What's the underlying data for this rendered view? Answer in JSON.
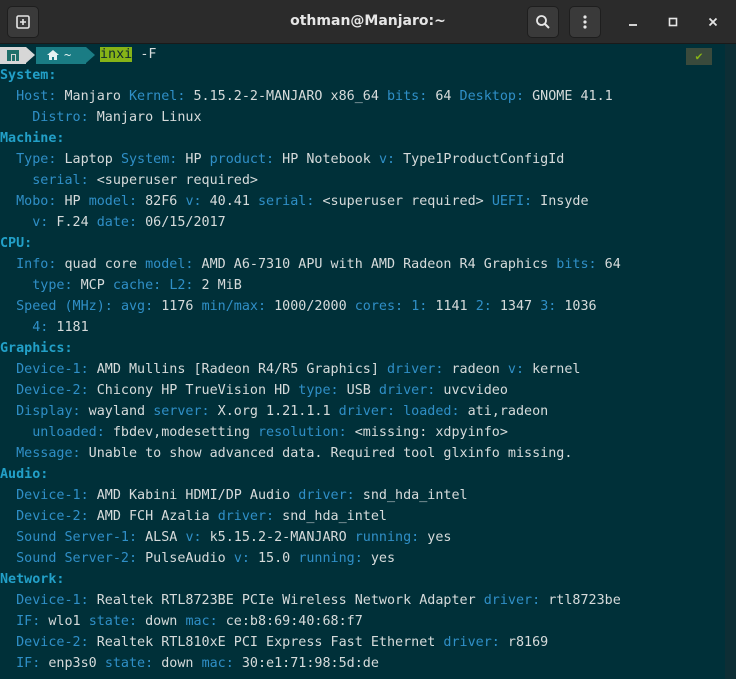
{
  "window": {
    "title": "othman@Manjaro:~"
  },
  "prompt": {
    "home_label": "~",
    "command": "inxi",
    "args": "-F",
    "status": "✔"
  },
  "colors": {
    "background": "#003039",
    "key": "#2f8fc7",
    "section": "#22a0c8",
    "value": "#d6dbdb",
    "command_highlight": "#86b317"
  },
  "output": [
    [
      {
        "t": "System:",
        "c": "s"
      }
    ],
    [
      {
        "t": "  Host:",
        "c": "k"
      },
      {
        "t": " Manjaro ",
        "c": "v"
      },
      {
        "t": "Kernel:",
        "c": "k"
      },
      {
        "t": " 5.15.2-2-MANJARO x86_64 ",
        "c": "v"
      },
      {
        "t": "bits:",
        "c": "k"
      },
      {
        "t": " 64 ",
        "c": "v"
      },
      {
        "t": "Desktop:",
        "c": "k"
      },
      {
        "t": " GNOME 41.1",
        "c": "v"
      }
    ],
    [
      {
        "t": "    Distro:",
        "c": "k"
      },
      {
        "t": " Manjaro Linux",
        "c": "v"
      }
    ],
    [
      {
        "t": "Machine:",
        "c": "s"
      }
    ],
    [
      {
        "t": "  Type:",
        "c": "k"
      },
      {
        "t": " Laptop ",
        "c": "v"
      },
      {
        "t": "System:",
        "c": "k"
      },
      {
        "t": " HP ",
        "c": "v"
      },
      {
        "t": "product:",
        "c": "k"
      },
      {
        "t": " HP Notebook ",
        "c": "v"
      },
      {
        "t": "v:",
        "c": "k"
      },
      {
        "t": " Type1ProductConfigId",
        "c": "v"
      }
    ],
    [
      {
        "t": "    serial:",
        "c": "k"
      },
      {
        "t": " <superuser required>",
        "c": "v"
      }
    ],
    [
      {
        "t": "  Mobo:",
        "c": "k"
      },
      {
        "t": " HP ",
        "c": "v"
      },
      {
        "t": "model:",
        "c": "k"
      },
      {
        "t": " 82F6 ",
        "c": "v"
      },
      {
        "t": "v:",
        "c": "k"
      },
      {
        "t": " 40.41 ",
        "c": "v"
      },
      {
        "t": "serial:",
        "c": "k"
      },
      {
        "t": " <superuser required> ",
        "c": "v"
      },
      {
        "t": "UEFI:",
        "c": "k"
      },
      {
        "t": " Insyde",
        "c": "v"
      }
    ],
    [
      {
        "t": "    v:",
        "c": "k"
      },
      {
        "t": " F.24 ",
        "c": "v"
      },
      {
        "t": "date:",
        "c": "k"
      },
      {
        "t": " 06/15/2017",
        "c": "v"
      }
    ],
    [
      {
        "t": "CPU:",
        "c": "s"
      }
    ],
    [
      {
        "t": "  Info:",
        "c": "k"
      },
      {
        "t": " quad core ",
        "c": "v"
      },
      {
        "t": "model:",
        "c": "k"
      },
      {
        "t": " AMD A6-7310 APU with AMD Radeon R4 Graphics ",
        "c": "v"
      },
      {
        "t": "bits:",
        "c": "k"
      },
      {
        "t": " 64",
        "c": "v"
      }
    ],
    [
      {
        "t": "    type:",
        "c": "k"
      },
      {
        "t": " MCP ",
        "c": "v"
      },
      {
        "t": "cache:",
        "c": "k"
      },
      {
        "t": " ",
        "c": "v"
      },
      {
        "t": "L2:",
        "c": "k"
      },
      {
        "t": " 2 MiB",
        "c": "v"
      }
    ],
    [
      {
        "t": "  Speed (MHz):",
        "c": "k"
      },
      {
        "t": " ",
        "c": "v"
      },
      {
        "t": "avg:",
        "c": "k"
      },
      {
        "t": " 1176 ",
        "c": "v"
      },
      {
        "t": "min/max:",
        "c": "k"
      },
      {
        "t": " 1000/2000 ",
        "c": "v"
      },
      {
        "t": "cores:",
        "c": "k"
      },
      {
        "t": " ",
        "c": "v"
      },
      {
        "t": "1:",
        "c": "k"
      },
      {
        "t": " 1141 ",
        "c": "v"
      },
      {
        "t": "2:",
        "c": "k"
      },
      {
        "t": " 1347 ",
        "c": "v"
      },
      {
        "t": "3:",
        "c": "k"
      },
      {
        "t": " 1036",
        "c": "v"
      }
    ],
    [
      {
        "t": "    4:",
        "c": "k"
      },
      {
        "t": " 1181",
        "c": "v"
      }
    ],
    [
      {
        "t": "Graphics:",
        "c": "s"
      }
    ],
    [
      {
        "t": "  Device-1:",
        "c": "k"
      },
      {
        "t": " AMD Mullins [Radeon R4/R5 Graphics] ",
        "c": "v"
      },
      {
        "t": "driver:",
        "c": "k"
      },
      {
        "t": " radeon ",
        "c": "v"
      },
      {
        "t": "v:",
        "c": "k"
      },
      {
        "t": " kernel",
        "c": "v"
      }
    ],
    [
      {
        "t": "  Device-2:",
        "c": "k"
      },
      {
        "t": " Chicony HP TrueVision HD ",
        "c": "v"
      },
      {
        "t": "type:",
        "c": "k"
      },
      {
        "t": " USB ",
        "c": "v"
      },
      {
        "t": "driver:",
        "c": "k"
      },
      {
        "t": " uvcvideo",
        "c": "v"
      }
    ],
    [
      {
        "t": "  Display:",
        "c": "k"
      },
      {
        "t": " wayland ",
        "c": "v"
      },
      {
        "t": "server:",
        "c": "k"
      },
      {
        "t": " X.org 1.21.1.1 ",
        "c": "v"
      },
      {
        "t": "driver:",
        "c": "k"
      },
      {
        "t": " ",
        "c": "v"
      },
      {
        "t": "loaded:",
        "c": "k"
      },
      {
        "t": " ati,radeon",
        "c": "v"
      }
    ],
    [
      {
        "t": "    unloaded:",
        "c": "k"
      },
      {
        "t": " fbdev,modesetting ",
        "c": "v"
      },
      {
        "t": "resolution:",
        "c": "k"
      },
      {
        "t": " <missing: xdpyinfo>",
        "c": "v"
      }
    ],
    [
      {
        "t": "  Message:",
        "c": "k"
      },
      {
        "t": " Unable to show advanced data. Required tool glxinfo missing.",
        "c": "v"
      }
    ],
    [
      {
        "t": "Audio:",
        "c": "s"
      }
    ],
    [
      {
        "t": "  Device-1:",
        "c": "k"
      },
      {
        "t": " AMD Kabini HDMI/DP Audio ",
        "c": "v"
      },
      {
        "t": "driver:",
        "c": "k"
      },
      {
        "t": " snd_hda_intel",
        "c": "v"
      }
    ],
    [
      {
        "t": "  Device-2:",
        "c": "k"
      },
      {
        "t": " AMD FCH Azalia ",
        "c": "v"
      },
      {
        "t": "driver:",
        "c": "k"
      },
      {
        "t": " snd_hda_intel",
        "c": "v"
      }
    ],
    [
      {
        "t": "  Sound Server-1:",
        "c": "k"
      },
      {
        "t": " ALSA ",
        "c": "v"
      },
      {
        "t": "v:",
        "c": "k"
      },
      {
        "t": " k5.15.2-2-MANJARO ",
        "c": "v"
      },
      {
        "t": "running:",
        "c": "k"
      },
      {
        "t": " yes",
        "c": "v"
      }
    ],
    [
      {
        "t": "  Sound Server-2:",
        "c": "k"
      },
      {
        "t": " PulseAudio ",
        "c": "v"
      },
      {
        "t": "v:",
        "c": "k"
      },
      {
        "t": " 15.0 ",
        "c": "v"
      },
      {
        "t": "running:",
        "c": "k"
      },
      {
        "t": " yes",
        "c": "v"
      }
    ],
    [
      {
        "t": "Network:",
        "c": "s"
      }
    ],
    [
      {
        "t": "  Device-1:",
        "c": "k"
      },
      {
        "t": " Realtek RTL8723BE PCIe Wireless Network Adapter ",
        "c": "v"
      },
      {
        "t": "driver:",
        "c": "k"
      },
      {
        "t": " rtl8723be",
        "c": "v"
      }
    ],
    [
      {
        "t": "  IF:",
        "c": "k"
      },
      {
        "t": " wlo1 ",
        "c": "v"
      },
      {
        "t": "state:",
        "c": "k"
      },
      {
        "t": " down ",
        "c": "v"
      },
      {
        "t": "mac:",
        "c": "k"
      },
      {
        "t": " ce:b8:69:40:68:f7",
        "c": "v"
      }
    ],
    [
      {
        "t": "  Device-2:",
        "c": "k"
      },
      {
        "t": " Realtek RTL810xE PCI Express Fast Ethernet ",
        "c": "v"
      },
      {
        "t": "driver:",
        "c": "k"
      },
      {
        "t": " r8169",
        "c": "v"
      }
    ],
    [
      {
        "t": "  IF:",
        "c": "k"
      },
      {
        "t": " enp3s0 ",
        "c": "v"
      },
      {
        "t": "state:",
        "c": "k"
      },
      {
        "t": " down ",
        "c": "v"
      },
      {
        "t": "mac:",
        "c": "k"
      },
      {
        "t": " 30:e1:71:98:5d:de",
        "c": "v"
      }
    ]
  ]
}
